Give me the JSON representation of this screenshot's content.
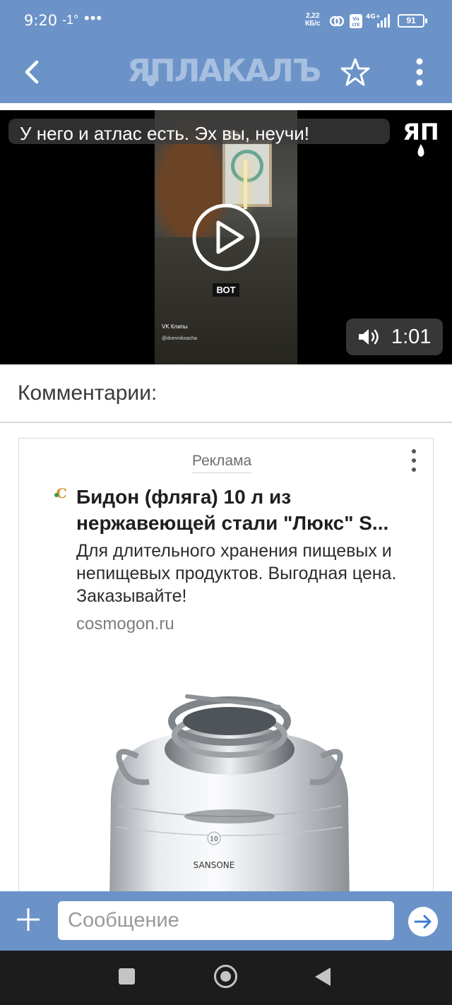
{
  "status_bar": {
    "time": "9:20",
    "temperature": "-1°",
    "dots": "•••",
    "net_speed_value": "2,22",
    "net_speed_unit": "КБ/с",
    "battery": "91"
  },
  "app_bar": {
    "logo": "ЯПЛАКАЛЪ"
  },
  "video": {
    "title": "У него и атлас есть. Эх вы, неучи!",
    "duration": "1:01",
    "thumb_caption": "ВОТ",
    "thumb_source": "VK Клипы",
    "thumb_handle": "@dnevnikxacha",
    "corner_logo": "ЯП"
  },
  "comments": {
    "heading": "Комментарии:"
  },
  "ad": {
    "label": "Реклама",
    "title": "Бидон (фляга) 10 л из нержавеющей стали \"Люкс\" S...",
    "description": "Для длительного хранения пищевых и непищевых продуктов. Выгодная цена. Заказывайте!",
    "domain": "cosmogon.ru",
    "product_brand": "SANSONE",
    "product_volume": "10"
  },
  "composer": {
    "placeholder": "Сообщение"
  },
  "colors": {
    "app_bar": "#6b93c8",
    "video_bg": "#000000",
    "nav_bar": "#1c1c1c"
  },
  "icons": {
    "back": "back-arrow-icon",
    "favorite": "star-icon",
    "menu": "kebab-menu-icon",
    "play": "play-icon",
    "sound": "speaker-icon",
    "add": "plus-icon",
    "send": "send-arrow-icon"
  }
}
